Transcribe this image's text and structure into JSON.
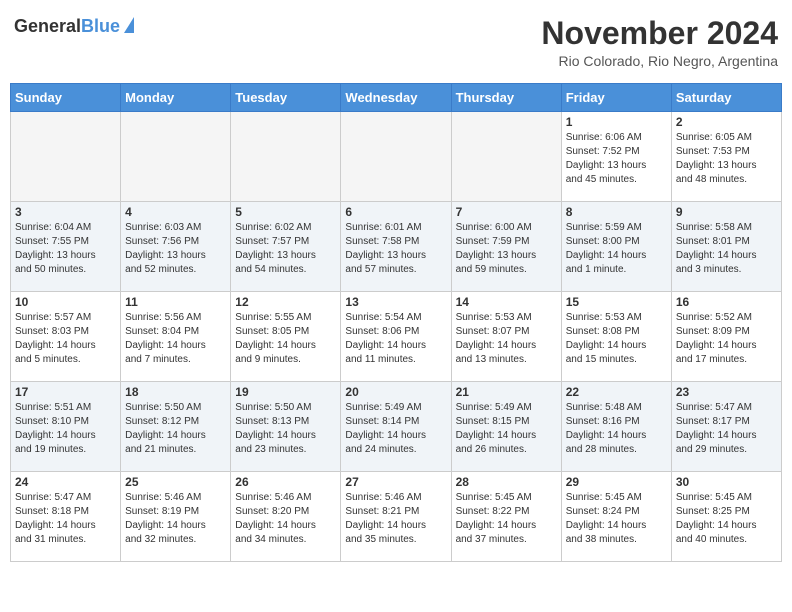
{
  "header": {
    "logo_general": "General",
    "logo_blue": "Blue",
    "month_year": "November 2024",
    "location": "Rio Colorado, Rio Negro, Argentina"
  },
  "days_of_week": [
    "Sunday",
    "Monday",
    "Tuesday",
    "Wednesday",
    "Thursday",
    "Friday",
    "Saturday"
  ],
  "weeks": [
    [
      {
        "day": "",
        "info": ""
      },
      {
        "day": "",
        "info": ""
      },
      {
        "day": "",
        "info": ""
      },
      {
        "day": "",
        "info": ""
      },
      {
        "day": "",
        "info": ""
      },
      {
        "day": "1",
        "info": "Sunrise: 6:06 AM\nSunset: 7:52 PM\nDaylight: 13 hours\nand 45 minutes."
      },
      {
        "day": "2",
        "info": "Sunrise: 6:05 AM\nSunset: 7:53 PM\nDaylight: 13 hours\nand 48 minutes."
      }
    ],
    [
      {
        "day": "3",
        "info": "Sunrise: 6:04 AM\nSunset: 7:55 PM\nDaylight: 13 hours\nand 50 minutes."
      },
      {
        "day": "4",
        "info": "Sunrise: 6:03 AM\nSunset: 7:56 PM\nDaylight: 13 hours\nand 52 minutes."
      },
      {
        "day": "5",
        "info": "Sunrise: 6:02 AM\nSunset: 7:57 PM\nDaylight: 13 hours\nand 54 minutes."
      },
      {
        "day": "6",
        "info": "Sunrise: 6:01 AM\nSunset: 7:58 PM\nDaylight: 13 hours\nand 57 minutes."
      },
      {
        "day": "7",
        "info": "Sunrise: 6:00 AM\nSunset: 7:59 PM\nDaylight: 13 hours\nand 59 minutes."
      },
      {
        "day": "8",
        "info": "Sunrise: 5:59 AM\nSunset: 8:00 PM\nDaylight: 14 hours\nand 1 minute."
      },
      {
        "day": "9",
        "info": "Sunrise: 5:58 AM\nSunset: 8:01 PM\nDaylight: 14 hours\nand 3 minutes."
      }
    ],
    [
      {
        "day": "10",
        "info": "Sunrise: 5:57 AM\nSunset: 8:03 PM\nDaylight: 14 hours\nand 5 minutes."
      },
      {
        "day": "11",
        "info": "Sunrise: 5:56 AM\nSunset: 8:04 PM\nDaylight: 14 hours\nand 7 minutes."
      },
      {
        "day": "12",
        "info": "Sunrise: 5:55 AM\nSunset: 8:05 PM\nDaylight: 14 hours\nand 9 minutes."
      },
      {
        "day": "13",
        "info": "Sunrise: 5:54 AM\nSunset: 8:06 PM\nDaylight: 14 hours\nand 11 minutes."
      },
      {
        "day": "14",
        "info": "Sunrise: 5:53 AM\nSunset: 8:07 PM\nDaylight: 14 hours\nand 13 minutes."
      },
      {
        "day": "15",
        "info": "Sunrise: 5:53 AM\nSunset: 8:08 PM\nDaylight: 14 hours\nand 15 minutes."
      },
      {
        "day": "16",
        "info": "Sunrise: 5:52 AM\nSunset: 8:09 PM\nDaylight: 14 hours\nand 17 minutes."
      }
    ],
    [
      {
        "day": "17",
        "info": "Sunrise: 5:51 AM\nSunset: 8:10 PM\nDaylight: 14 hours\nand 19 minutes."
      },
      {
        "day": "18",
        "info": "Sunrise: 5:50 AM\nSunset: 8:12 PM\nDaylight: 14 hours\nand 21 minutes."
      },
      {
        "day": "19",
        "info": "Sunrise: 5:50 AM\nSunset: 8:13 PM\nDaylight: 14 hours\nand 23 minutes."
      },
      {
        "day": "20",
        "info": "Sunrise: 5:49 AM\nSunset: 8:14 PM\nDaylight: 14 hours\nand 24 minutes."
      },
      {
        "day": "21",
        "info": "Sunrise: 5:49 AM\nSunset: 8:15 PM\nDaylight: 14 hours\nand 26 minutes."
      },
      {
        "day": "22",
        "info": "Sunrise: 5:48 AM\nSunset: 8:16 PM\nDaylight: 14 hours\nand 28 minutes."
      },
      {
        "day": "23",
        "info": "Sunrise: 5:47 AM\nSunset: 8:17 PM\nDaylight: 14 hours\nand 29 minutes."
      }
    ],
    [
      {
        "day": "24",
        "info": "Sunrise: 5:47 AM\nSunset: 8:18 PM\nDaylight: 14 hours\nand 31 minutes."
      },
      {
        "day": "25",
        "info": "Sunrise: 5:46 AM\nSunset: 8:19 PM\nDaylight: 14 hours\nand 32 minutes."
      },
      {
        "day": "26",
        "info": "Sunrise: 5:46 AM\nSunset: 8:20 PM\nDaylight: 14 hours\nand 34 minutes."
      },
      {
        "day": "27",
        "info": "Sunrise: 5:46 AM\nSunset: 8:21 PM\nDaylight: 14 hours\nand 35 minutes."
      },
      {
        "day": "28",
        "info": "Sunrise: 5:45 AM\nSunset: 8:22 PM\nDaylight: 14 hours\nand 37 minutes."
      },
      {
        "day": "29",
        "info": "Sunrise: 5:45 AM\nSunset: 8:24 PM\nDaylight: 14 hours\nand 38 minutes."
      },
      {
        "day": "30",
        "info": "Sunrise: 5:45 AM\nSunset: 8:25 PM\nDaylight: 14 hours\nand 40 minutes."
      }
    ]
  ]
}
